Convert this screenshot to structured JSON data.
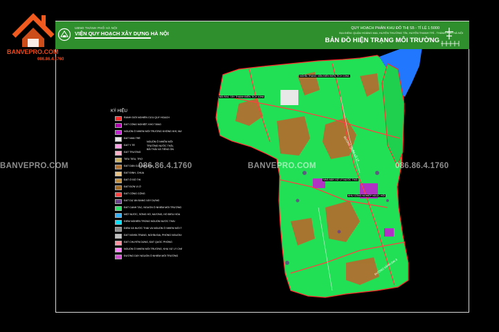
{
  "brand": {
    "name": "BANVEPRO.COM",
    "phone": "086.86.4.1760",
    "colors": {
      "accent": "#e84a1e",
      "roof": "#f05a1f"
    }
  },
  "header": {
    "org_parent": "UBND THÀNH PHỐ HÀ NỘI",
    "org_name": "VIỆN QUY HOẠCH XÂY DỰNG HÀ NỘI",
    "plan_title": "QUY HOẠCH PHÂN KHU ĐÔ THỊ S5 - TỈ LỆ 1:5000",
    "plan_location": "ĐỊA ĐIỂM: QUẬN HOÀNG MAI, HUYỆN THƯỜNG TÍN, HUYỆN THANH TRÌ - THÀNH PHỐ HÀ NỘI",
    "map_name": "BẢN ĐỒ HIỆN TRẠNG MÔI TRƯỜNG",
    "band_color": "#2f8f2c"
  },
  "legend": {
    "title": "KÝ HIỆU",
    "items": [
      {
        "color": "#ff2a2a",
        "label": "RANH GIỚI NGHIÊN CỨU QUY HOẠCH"
      },
      {
        "color": "#b000b0",
        "label": "ĐẤT CÔNG NGHIỆP, KHO TÀNG"
      },
      {
        "color": "#c020d0",
        "label": "NGUỒN Ô NHIỄM MÔI TRƯỜNG KHÔNG KHÍ, NƯỚC THẢI, CHẤT THẢI RẮN"
      },
      {
        "color": "#e8e8e8",
        "label": "ĐẤT NHÀ TRẺ"
      },
      {
        "color": "#ff9de6",
        "label": "ĐẤT Y TẾ"
      },
      {
        "color": "#ffb0c8",
        "label": "ĐẤT TRƯỜNG"
      },
      {
        "color": "#c8b060",
        "label": "TIỂU TIỂU, TRỢ"
      },
      {
        "color": "#b07030",
        "label": "ĐẤT DÂN CƯ LÀNG XÓM"
      },
      {
        "color": "#e8c080",
        "label": "ĐẤT ĐÌNH, CHÙA"
      },
      {
        "color": "#c09040",
        "label": "ĐẤT Ở ĐÔ THỊ"
      },
      {
        "color": "#a06820",
        "label": "ĐẤT ĐƠN VỊ Ở"
      },
      {
        "color": "#ff4040",
        "label": "ĐẤT CÔNG CỘNG"
      },
      {
        "color": "#6a3f8a",
        "label": "ĐẤT DỰ ÁN ĐANG XÂY DỰNG"
      },
      {
        "color": "#2ce06a",
        "label": "ĐẤT CANH TÁC, NGUỒN Ô NHIỄM MÔI TRƯỜNG NƯỚC, KHÔNG KHÍ DO THUỐC BẢO VỆ THỰC VẬT, PHÂN BÓN"
      },
      {
        "color": "#30b0ff",
        "label": "MẶT NƯỚC, SÔNG HỒ, MƯƠNG, HỒ ĐIỀU HÒA"
      },
      {
        "color": "#00e0ff",
        "label": "ĐIỂM NGHIÊN TRONG NGUỒN NƯỚC THẢI"
      },
      {
        "color": "#8a8a8a",
        "label": "ĐIỂM XẢ NƯỚC THẢI VÀ NGUỒN Ô NHIỄM MÔI TRƯỜNG"
      },
      {
        "color": "#c0c0c0",
        "label": "ĐẤT NGHĨA TRANG, NGHĨA ĐỊA, PHÒNG NGUỒN Ô NHIỄM MÔI TRƯỜNG NƯỚC THẢI"
      },
      {
        "color": "#ff90a0",
        "label": "ĐẤT CHUYÊN DÙNG, ĐẤT QUỐC PHÒNG"
      },
      {
        "color": "#ff80ff",
        "label": "NGUỒN Ô NHIỄM MÔI TRƯỜNG, KHU XỬ LÝ CHẤT THẢI"
      },
      {
        "color": "#d050d0",
        "label": "ĐƯỜNG DÂY NGUỒN Ô NHIỄM MÔI TRƯỜNG"
      }
    ],
    "side_note": "NGUỒN Ô NHIỄM MÔI TRƯỜNG NƯỚC THẢI, BÃI THẢI VÀ TIẾNG ỒN"
  },
  "map_notes": {
    "note_north": "NGHĨA TRANG VĂN ĐIỂN ĐIỆN TÍCH 10HA",
    "note_west": "BÃI RÁC TÂY THANH ĐIỆN TÍCH 10HA",
    "note_center": "NHÀ MÁY XỬ LÝ NƯỚC THẢI",
    "note_center_2": "KHU CÔNG NGHIỆP NGỌC HỒI",
    "road_1": "ĐƯỜNG QUỐC LỘ 1A",
    "road_2": "ĐƯỜNG VÀNH ĐAI 3"
  },
  "map_colors": {
    "land": "#22e056",
    "village": "#b07030",
    "industry": "#c020d0",
    "water": "#2277ff",
    "boundary": "#ff2a2a",
    "road": "#ff4040"
  },
  "watermarks": [
    "BANVEPRO.COM",
    "086.86.4.1760",
    "BANVEPRO.COM",
    "086.86.4.1760"
  ]
}
